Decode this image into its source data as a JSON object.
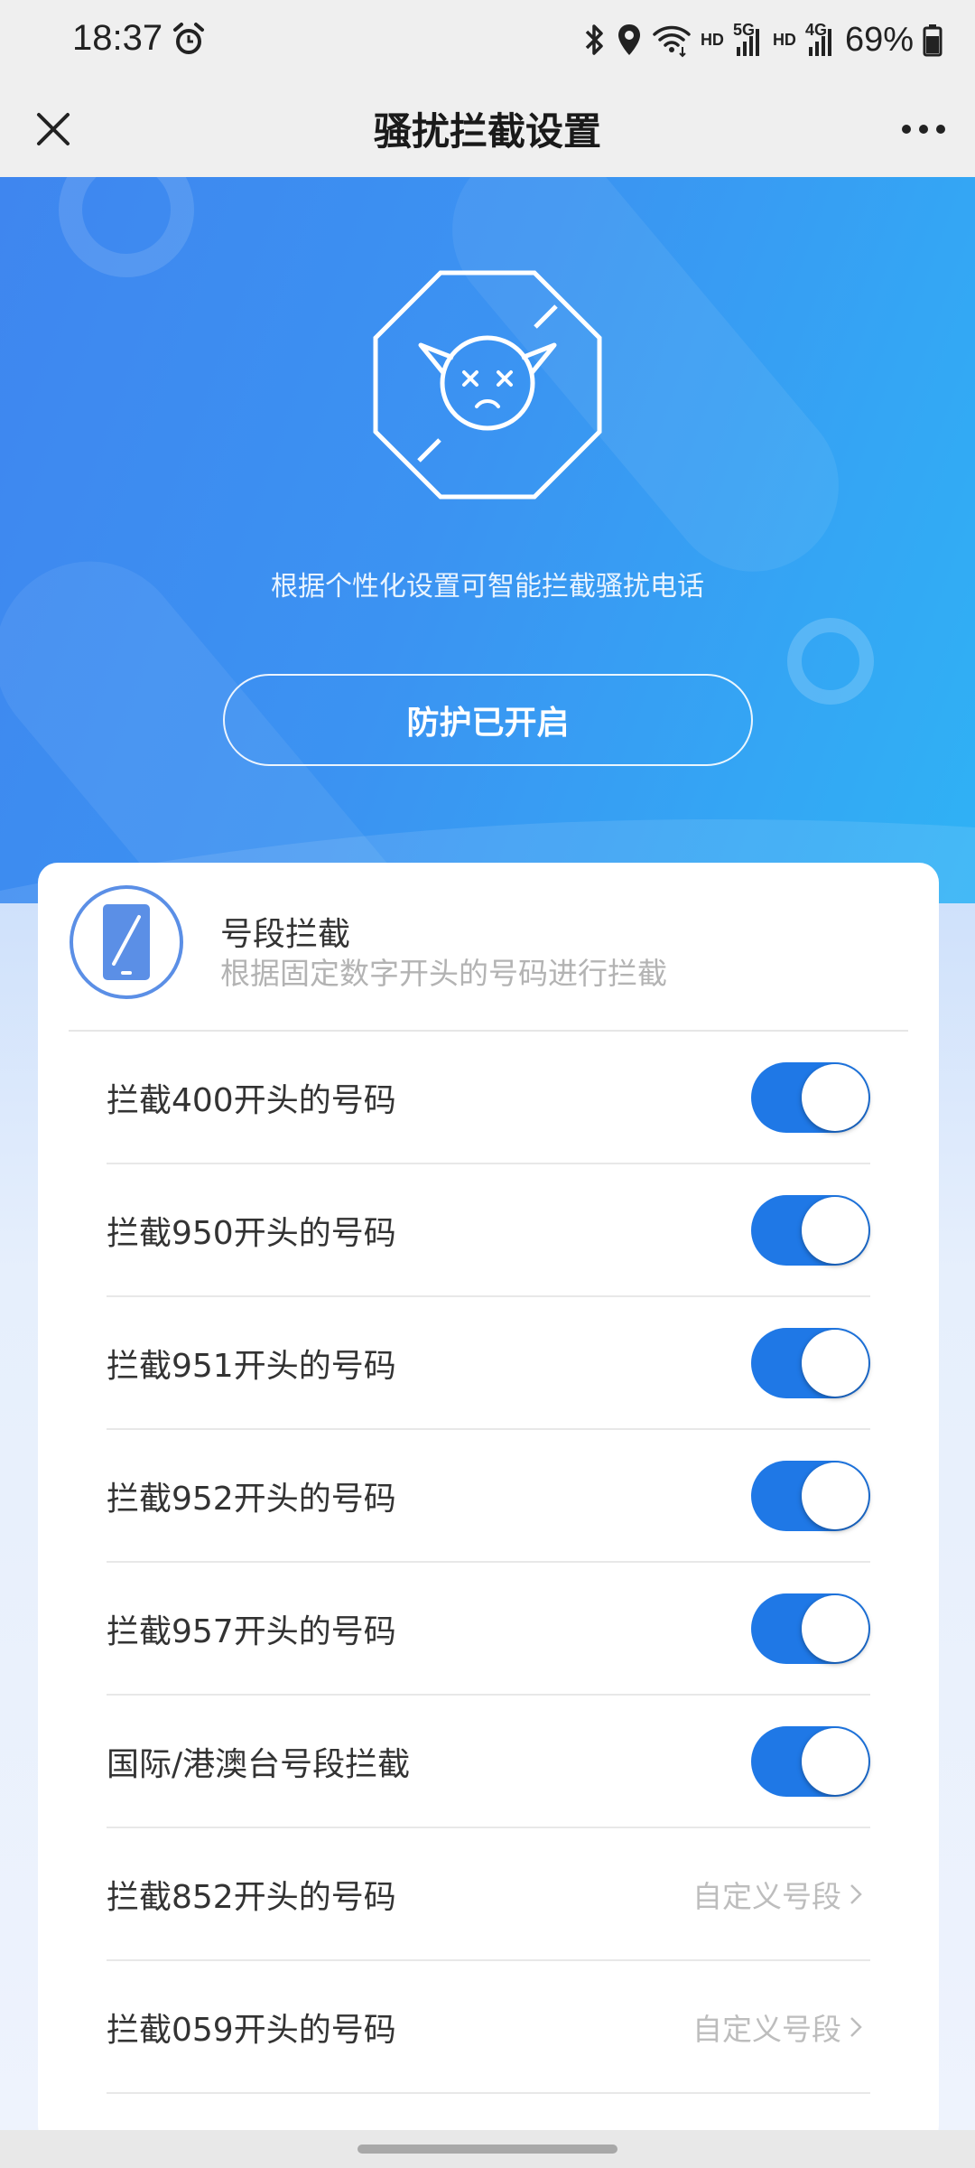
{
  "status_bar": {
    "time": "18:37",
    "net_hd_1": "HD",
    "net_5g": "5G",
    "net_hd_2": "HD",
    "net_4g": "4G",
    "battery": "69%"
  },
  "app_bar": {
    "title": "骚扰拦截设置"
  },
  "hero": {
    "description": "根据个性化设置可智能拦截骚扰电话",
    "protect_button": "防护已开启"
  },
  "card": {
    "title": "号段拦截",
    "subtitle": "根据固定数字开头的号码进行拦截",
    "rows": [
      {
        "label": "拦截400开头的号码",
        "type": "toggle",
        "on": true
      },
      {
        "label": "拦截950开头的号码",
        "type": "toggle",
        "on": true
      },
      {
        "label": "拦截951开头的号码",
        "type": "toggle",
        "on": true
      },
      {
        "label": "拦截952开头的号码",
        "type": "toggle",
        "on": true
      },
      {
        "label": "拦截957开头的号码",
        "type": "toggle",
        "on": true
      },
      {
        "label": "国际/港澳台号段拦截",
        "type": "toggle",
        "on": true
      },
      {
        "label": "拦截852开头的号码",
        "type": "link",
        "link_text": "自定义号段"
      },
      {
        "label": "拦截059开头的号码",
        "type": "link",
        "link_text": "自定义号段"
      }
    ]
  },
  "colors": {
    "accent": "#1f78e6",
    "hero_start": "#3f86ef",
    "hero_end": "#2fb3f5"
  },
  "icons": [
    "alarm-icon",
    "bluetooth-icon",
    "location-icon",
    "wifi-icon",
    "signal-icon",
    "battery-icon",
    "close-icon",
    "more-icon",
    "shield-icon",
    "phone-icon",
    "chevron-right-icon"
  ]
}
